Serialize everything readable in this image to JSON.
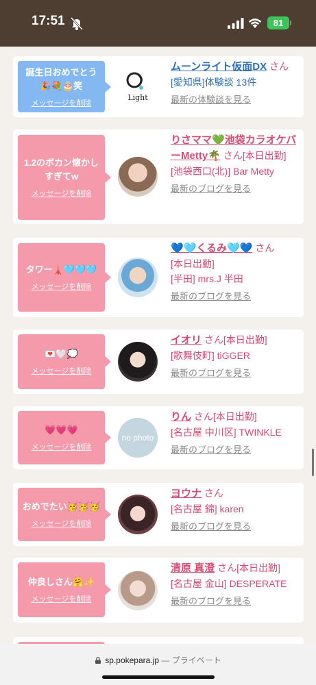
{
  "status_bar": {
    "time": "17:51",
    "battery": "81"
  },
  "cards": [
    {
      "bubble_color": "blue",
      "message": "誕生日おめでとう🎉💐🎂笑",
      "delete_label": "メッセージを削除",
      "avatar": "logo",
      "logo_text": "Light",
      "name": "ムーンライト仮面DX",
      "name_color": "blue",
      "san": "さん",
      "extra": "",
      "detail": "[愛知県]体験談 13件",
      "link": "最新の体験談を見る"
    },
    {
      "bubble_color": "pink",
      "message": "1.2のボカン懐かしすぎてw",
      "delete_label": "メッセージを削除",
      "avatar": "photo",
      "name": "りさママ💚池袋カラオケバーMetty🌴",
      "san": "さん",
      "extra": "[本日出勤]",
      "detail": "[池袋西口(北)] Bar Metty",
      "link": "最新のブログを見る"
    },
    {
      "bubble_color": "pink",
      "message": "タワー🗼🩵🩵🩵",
      "delete_label": "メッセージを削除",
      "avatar": "photo",
      "name": "💙🩵くるみ🩵💙",
      "san": "さん",
      "extra": "[本日出勤]",
      "detail": "[半田] mrs.J 半田",
      "link": "最新のブログを見る"
    },
    {
      "bubble_color": "pink",
      "message": "💌🤍💭",
      "delete_label": "メッセージを削除",
      "avatar": "photo",
      "name": "イオリ",
      "san": "さん",
      "extra": "[本日出勤]",
      "detail": "[歌舞伎町] tiGGER",
      "link": "最新のブログを見る"
    },
    {
      "bubble_color": "pink",
      "message": "💗💗💗",
      "delete_label": "メッセージを削除",
      "avatar": "nophoto",
      "nophoto_text": "no photo",
      "name": "りん",
      "san": "さん",
      "extra": "[本日出勤]",
      "detail": "[名古屋 中川区] TWINKLE",
      "link": "最新のブログを見る"
    },
    {
      "bubble_color": "pink",
      "message": "おめでたい🥳🥳🥳",
      "delete_label": "メッセージを削除",
      "avatar": "photo",
      "name": "ヨウナ",
      "san": "さん",
      "extra": "",
      "detail": "[名古屋 錦] karen",
      "link": "最新のブログを見る"
    },
    {
      "bubble_color": "pink",
      "message": "仲良しさん🤗✨",
      "delete_label": "メッセージを削除",
      "avatar": "photo",
      "name": "清原 真澄",
      "san": "さん",
      "extra": "[本日出勤]",
      "detail": "[名古屋 金山] DESPERATE",
      "link": "最新のブログを見る"
    }
  ],
  "url_bar": {
    "domain": "sp.pokepara.jp",
    "separator": "—",
    "mode": "プライベート"
  }
}
